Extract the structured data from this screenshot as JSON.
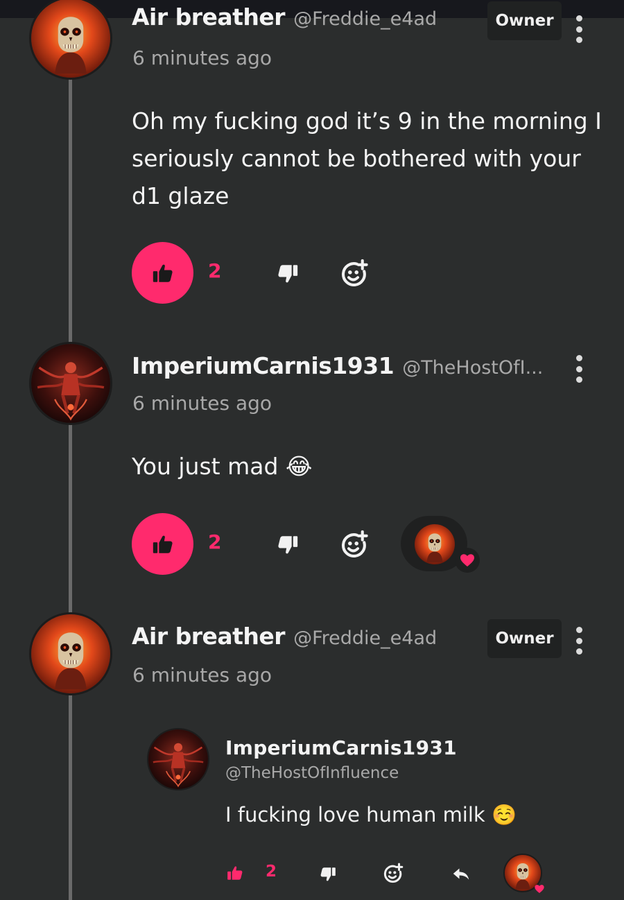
{
  "comments": [
    {
      "author": "Air breather",
      "handle": "@Freddie_e4ad",
      "badge": "Owner",
      "time": "6 minutes ago",
      "text": "Oh my fucking god it’s 9 in the morning I seriously cannot be bothered with your d1 glaze",
      "likes": "2",
      "liked": true
    },
    {
      "author": "ImperiumCarnis1931",
      "handle": "@TheHostOfI...",
      "time": "6 minutes ago",
      "text": "You just mad 😂",
      "likes": "2",
      "liked": true
    },
    {
      "author": "Air breather",
      "handle": "@Freddie_e4ad",
      "badge": "Owner",
      "time": "6 minutes ago",
      "quoted": {
        "author": "ImperiumCarnis1931",
        "handle": "@TheHostOfInfluence",
        "text": "I fucking love human milk ☺️",
        "likes": "2"
      }
    }
  ],
  "icons": {
    "like": "thumbs-up-icon",
    "dislike": "thumbs-down-icon",
    "react": "add-reaction-icon",
    "reply": "reply-icon",
    "more": "more-vertical-icon",
    "heart": "heart-icon"
  },
  "colors": {
    "accent": "#ff2a6d",
    "background": "#2b2d2d",
    "badge_bg": "#202222"
  }
}
